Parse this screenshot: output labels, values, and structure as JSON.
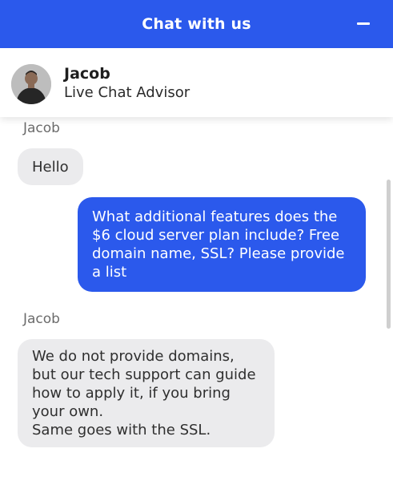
{
  "header": {
    "title": "Chat with us",
    "minimize_icon": "minus-icon"
  },
  "agent": {
    "name": "Jacob",
    "role": "Live Chat Advisor",
    "avatar_icon": "user-avatar"
  },
  "messages": [
    {
      "from": "agent",
      "sender": "Jacob",
      "lines": [
        "Hello"
      ]
    },
    {
      "from": "user",
      "lines": [
        "What additional features does the",
        "$6 cloud server plan include? Free",
        "domain name, SSL? Please provide",
        "a list"
      ]
    },
    {
      "from": "agent",
      "sender": "Jacob",
      "lines": [
        "We do not provide domains,",
        "but our tech support can guide",
        "how to apply it, if you bring",
        "your own.",
        "Same goes with the SSL."
      ]
    }
  ],
  "colors": {
    "accent": "#2b59ec",
    "incoming_bubble": "#ebebed"
  }
}
